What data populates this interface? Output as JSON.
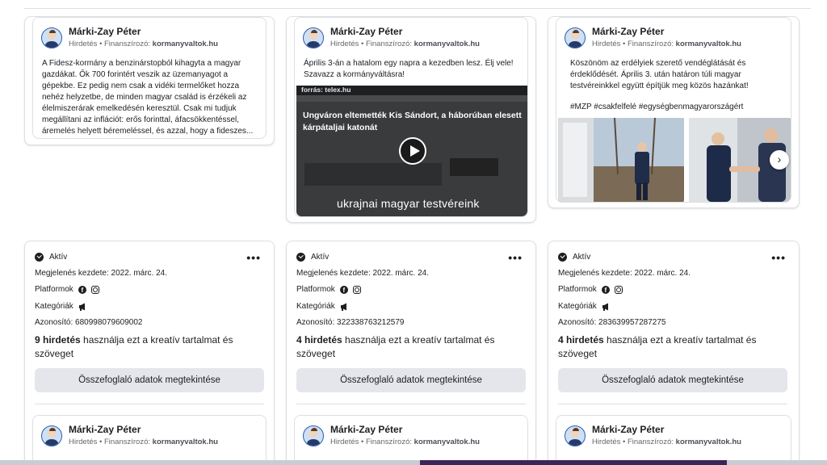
{
  "ads_top": [
    {
      "advertiser": "Márki-Zay Péter",
      "label": "Hirdetés",
      "financed_by": "Finanszírozó:",
      "sponsor": "kormanyvaltok.hu",
      "body": "A Fidesz-kormány a benzinárstopból kihagyta a magyar gazdákat. Ők 700 forintért veszik az üzemanyagot a gépekbe. Ez pedig nem csak a vidéki termelőket hozza nehéz helyzetbe, de minden magyar család is érzékeli az élelmiszerárak emelkedésén keresztül. Csak mi tudjuk megállítani az inflációt: erős forinttal, áfacsökkentéssel, áremelés helyett béremeléssel, és azzal, hogy a fideszes..."
    },
    {
      "advertiser": "Márki-Zay Péter",
      "label": "Hirdetés",
      "financed_by": "Finanszírozó:",
      "sponsor": "kormanyvaltok.hu",
      "body": "Április 3-án a hatalom egy napra a kezedben lesz. Élj vele! Szavazz a kormányváltásra!",
      "video": {
        "source": "forrás: telex.hu",
        "title": "Ungváron eltemették Kis Sándort, a háborúban elesett kárpátaljai katonát",
        "caption": "ukrajnai magyar testvéreink"
      }
    },
    {
      "advertiser": "Márki-Zay Péter",
      "label": "Hirdetés",
      "financed_by": "Finanszírozó:",
      "sponsor": "kormanyvaltok.hu",
      "body": "Köszönöm az erdélyiek szerető vendéglátását és érdeklődését. Április 3. után határon túli magyar testvéreinkkel együtt építjük meg közös hazánkat!",
      "hashtags": "#MZP #csakfelfelé #egységbenmagyarországért",
      "next": "›"
    }
  ],
  "cards": [
    {
      "status": "Aktív",
      "more": "•••",
      "start_label": "Megjelenés kezdete:",
      "start_date": "2022. márc. 24.",
      "platforms_label": "Platformok",
      "categories_label": "Kategóriák",
      "id_label": "Azonosító:",
      "id": "680998079609002",
      "uses_count": "9 hirdetés",
      "uses_text": "használja ezt a kreatív tartalmat és szöveget",
      "button": "Összefoglaló adatok megtekintése",
      "preview": {
        "advertiser": "Márki-Zay Péter",
        "label": "Hirdetés",
        "financed_by": "Finanszírozó:",
        "sponsor": "kormanyvaltok.hu"
      }
    },
    {
      "status": "Aktív",
      "more": "•••",
      "start_label": "Megjelenés kezdete:",
      "start_date": "2022. márc. 24.",
      "platforms_label": "Platformok",
      "categories_label": "Kategóriák",
      "id_label": "Azonosító:",
      "id": "322338763212579",
      "uses_count": "4 hirdetés",
      "uses_text": "használja ezt a kreatív tartalmat és szöveget",
      "button": "Összefoglaló adatok megtekintése",
      "preview": {
        "advertiser": "Márki-Zay Péter",
        "label": "Hirdetés",
        "financed_by": "Finanszírozó:",
        "sponsor": "kormanyvaltok.hu"
      }
    },
    {
      "status": "Aktív",
      "more": "•••",
      "start_label": "Megjelenés kezdete:",
      "start_date": "2022. márc. 24.",
      "platforms_label": "Platformok",
      "categories_label": "Kategóriák",
      "id_label": "Azonosító:",
      "id": "283639957287275",
      "uses_count": "4 hirdetés",
      "uses_text": "használja ezt a kreatív tartalmat és szöveget",
      "button": "Összefoglaló adatok megtekintése",
      "preview": {
        "advertiser": "Márki-Zay Péter",
        "label": "Hirdetés",
        "financed_by": "Finanszírozó:",
        "sponsor": "kormanyvaltok.hu"
      }
    }
  ],
  "icons": {
    "status": "check-circle-icon",
    "platform_1": "facebook-icon",
    "platform_2": "instagram-icon",
    "category": "megaphone-icon",
    "video": "play-icon",
    "carousel": "chevron-right-icon"
  }
}
